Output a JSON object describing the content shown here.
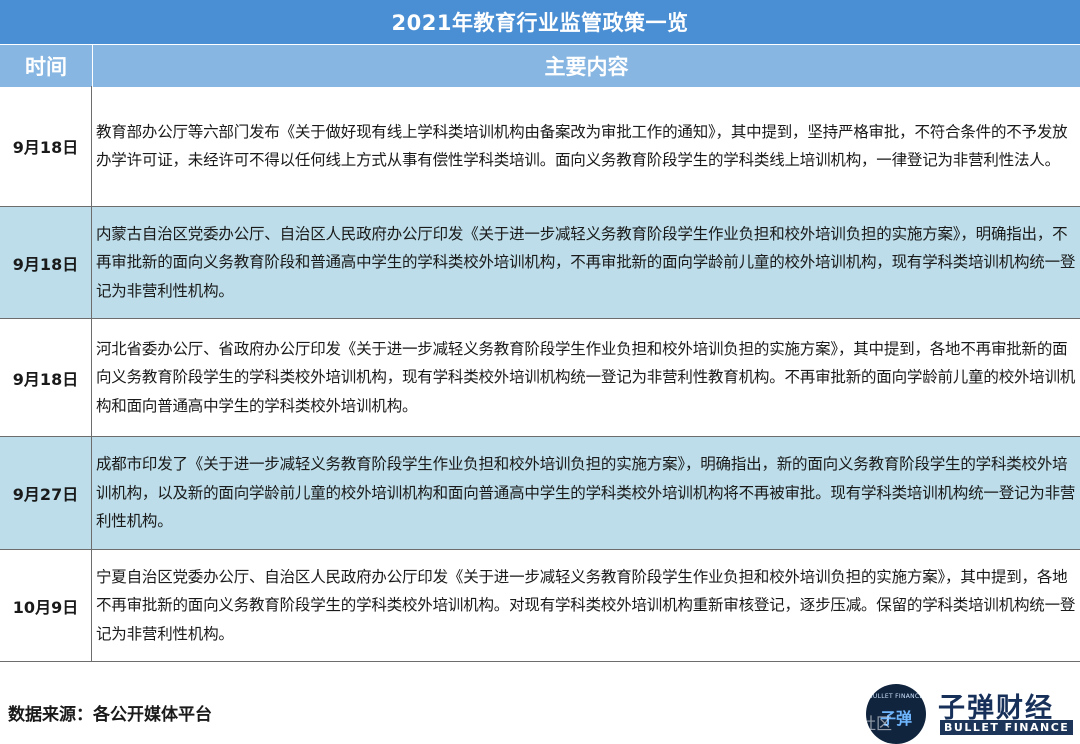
{
  "title": "2021年教育行业监管政策一览",
  "header": {
    "time": "时间",
    "content": "主要内容"
  },
  "rows": [
    {
      "date": "9月18日",
      "content": "教育部办公厅等六部门发布《关于做好现有线上学科类培训机构由备案改为审批工作的通知》，其中提到，坚持严格审批，不符合条件的不予发放办学许可证，未经许可不得以任何线上方式从事有偿性学科类培训。面向义务教育阶段学生的学科类线上培训机构，一律登记为非营利性法人。"
    },
    {
      "date": "9月18日",
      "content": "内蒙古自治区党委办公厅、自治区人民政府办公厅印发《关于进一步减轻义务教育阶段学生作业负担和校外培训负担的实施方案》，明确指出，不再审批新的面向义务教育阶段和普通高中学生的学科类校外培训机构，不再审批新的面向学龄前儿童的校外培训机构，现有学科类培训机构统一登记为非营利性机构。"
    },
    {
      "date": "9月18日",
      "content": "河北省委办公厅、省政府办公厅印发《关于进一步减轻义务教育阶段学生作业负担和校外培训负担的实施方案》，其中提到，各地不再审批新的面向义务教育阶段学生的学科类校外培训机构，现有学科类校外培训机构统一登记为非营利性教育机构。不再审批新的面向学龄前儿童的校外培训机构和面向普通高中学生的学科类校外培训机构。"
    },
    {
      "date": "9月27日",
      "content": "成都市印发了《关于进一步减轻义务教育阶段学生作业负担和校外培训负担的实施方案》，明确指出，新的面向义务教育阶段学生的学科类校外培训机构，以及新的面向学龄前儿童的校外培训机构和面向普通高中学生的学科类校外培训机构将不再被审批。现有学科类培训机构统一登记为非营利性机构。"
    },
    {
      "date": "10月9日",
      "content": "宁夏自治区党委办公厅、自治区人民政府办公厅印发《关于进一步减轻义务教育阶段学生作业负担和校外培训负担的实施方案》，其中提到，各地不再审批新的面向义务教育阶段学生的学科类校外培训机构。对现有学科类校外培训机构重新审核登记，逐步压减。保留的学科类培训机构统一登记为非营利性机构。"
    }
  ],
  "footer": {
    "source": "数据来源：各公开媒体平台",
    "brand_name": "子弹财经",
    "brand_sub": "BULLET FINANCE",
    "brand_mark_small": "BULLET FINANCE",
    "brand_mark_big": "子弹",
    "watermark": "社区"
  },
  "colors": {
    "title_bg": "#4a8fd4",
    "header_bg": "#86b6e1",
    "alt_row_bg": "#bcdde9"
  }
}
